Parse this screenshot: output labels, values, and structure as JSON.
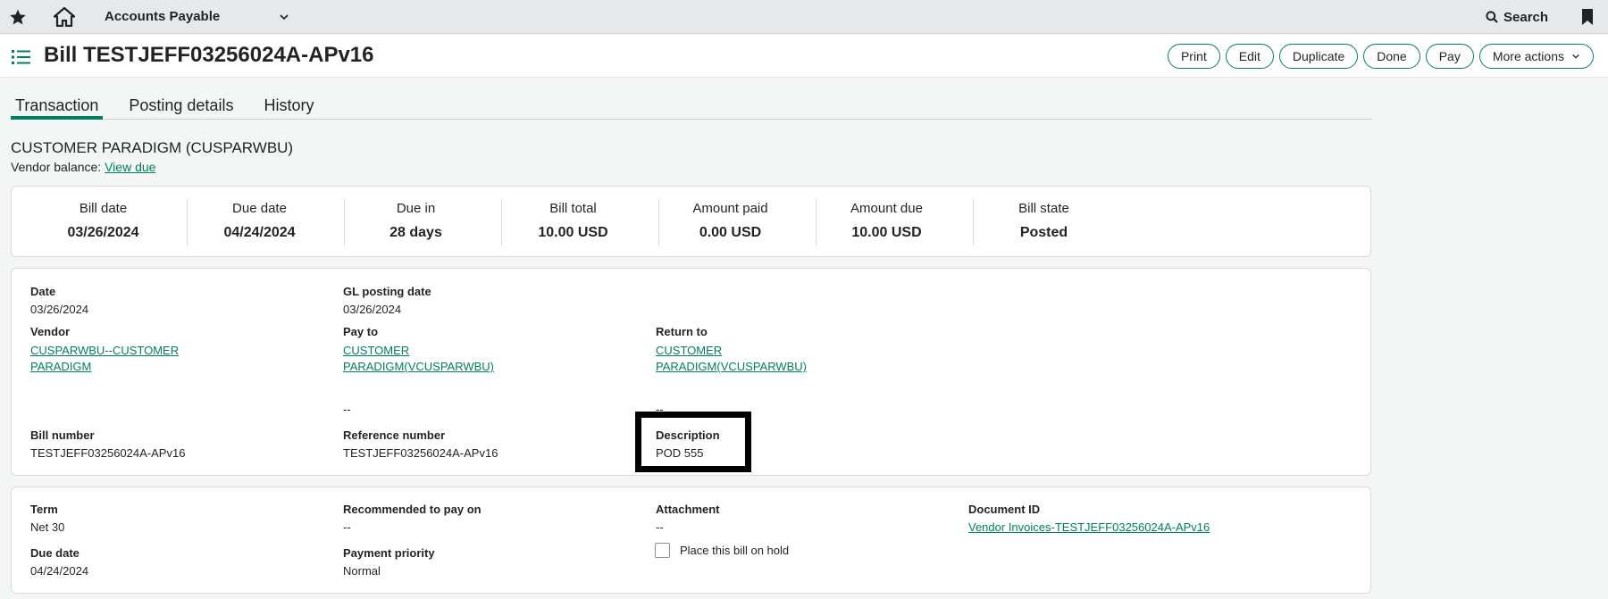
{
  "topbar": {
    "module": "Accounts Payable",
    "search_label": "Search"
  },
  "header": {
    "title": "Bill TESTJEFF03256024A-APv16",
    "actions": [
      "Print",
      "Edit",
      "Duplicate",
      "Done",
      "Pay",
      "More actions"
    ]
  },
  "tabs": [
    "Transaction",
    "Posting details",
    "History"
  ],
  "vendor": {
    "name": "CUSTOMER PARADIGM (CUSPARWBU)",
    "balance_label": "Vendor balance:",
    "balance_link": "View due"
  },
  "summary": [
    {
      "label": "Bill date",
      "value": "03/26/2024"
    },
    {
      "label": "Due date",
      "value": "04/24/2024"
    },
    {
      "label": "Due in",
      "value": "28 days"
    },
    {
      "label": "Bill total",
      "value": "10.00 USD"
    },
    {
      "label": "Amount paid",
      "value": "0.00 USD"
    },
    {
      "label": "Amount due",
      "value": "10.00 USD"
    },
    {
      "label": "Bill state",
      "value": "Posted"
    }
  ],
  "details": {
    "date_label": "Date",
    "date_value": "03/26/2024",
    "gl_label": "GL posting date",
    "gl_value": "03/26/2024",
    "vendor_label": "Vendor",
    "vendor_line1": "CUSPARWBU--CUSTOMER",
    "vendor_line2": "PARADIGM",
    "payto_label": "Pay to",
    "payto_line1": "CUSTOMER",
    "payto_line2": "PARADIGM(VCUSPARWBU)",
    "returnto_label": "Return to",
    "returnto_line1": "CUSTOMER",
    "returnto_line2": "PARADIGM(VCUSPARWBU)",
    "payto_dash": "--",
    "returnto_dash": "--",
    "billnum_label": "Bill number",
    "billnum_value": "TESTJEFF03256024A-APv16",
    "refnum_label": "Reference number",
    "refnum_value": "TESTJEFF03256024A-APv16",
    "desc_label": "Description",
    "desc_value": "POD 555"
  },
  "terms": {
    "term_label": "Term",
    "term_value": "Net 30",
    "recpay_label": "Recommended to pay on",
    "recpay_value": "--",
    "attach_label": "Attachment",
    "attach_value": "--",
    "docid_label": "Document ID",
    "docid_value": "Vendor Invoices-TESTJEFF03256024A-APv16",
    "duedate_label": "Due date",
    "duedate_value": "04/24/2024",
    "priority_label": "Payment priority",
    "priority_value": "Normal",
    "hold_label": "Place this bill on hold"
  },
  "colors": {
    "accent": "#00815d",
    "highlight_border": "#000000"
  }
}
